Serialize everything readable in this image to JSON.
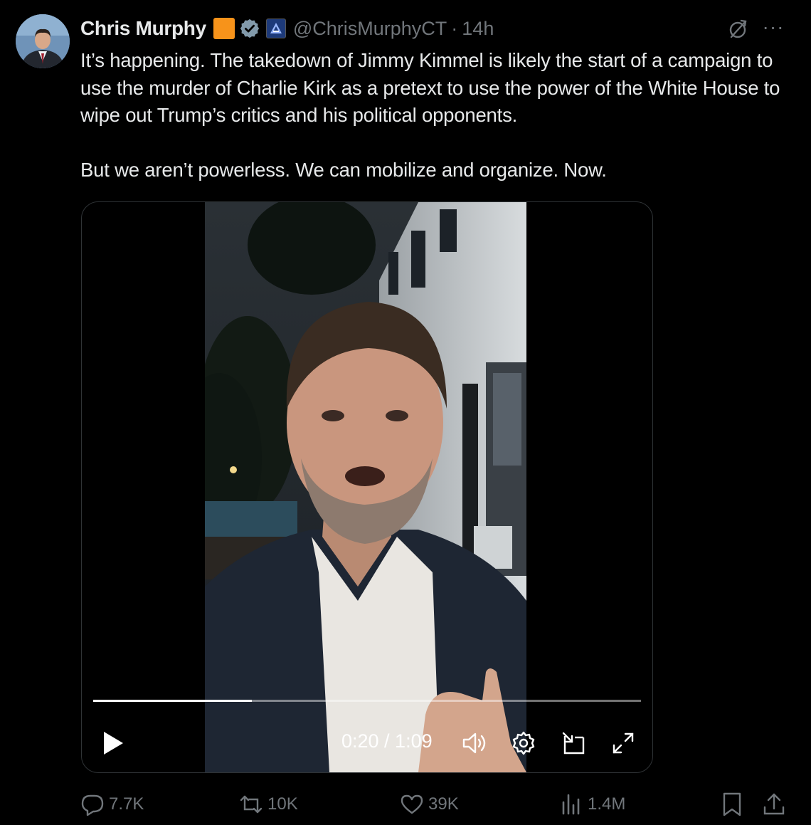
{
  "author": {
    "name": "Chris Murphy",
    "handle": "@ChrisMurphyCT",
    "separator": "·",
    "time": "14h"
  },
  "tweet": {
    "paragraphs": [
      "It’s happening. The takedown of Jimmy Kimmel is likely the start of a campaign to use the murder of Charlie Kirk as a pretext to use the power of the White House to wipe out Trump’s critics and his political opponents.",
      "But we aren’t powerless. We can mobilize and organize. Now."
    ]
  },
  "video": {
    "timecode": "0:20 / 1:09",
    "progress_fraction": 0.29
  },
  "actions": {
    "replies": "7.7K",
    "reposts": "10K",
    "likes": "39K",
    "views": "1.4M"
  },
  "colors": {
    "background": "#000000",
    "text": "#e7e9ea",
    "muted": "#71767b",
    "verified_badge": "#829aab",
    "square_badge": "#f7931a"
  }
}
